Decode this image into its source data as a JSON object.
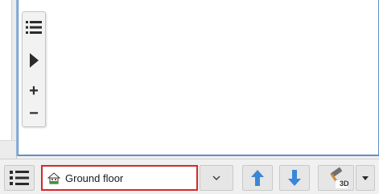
{
  "palette": {
    "items": [
      {
        "name": "list-icon"
      },
      {
        "name": "play-icon"
      },
      {
        "name": "zoom-in-icon",
        "glyph": "+"
      },
      {
        "name": "zoom-out-icon",
        "glyph": "−"
      }
    ]
  },
  "toolbar": {
    "floor_selector": {
      "value": "Ground floor",
      "icon": "floor-house-icon"
    },
    "buttons": [
      {
        "name": "levels-list-button",
        "icon": "list-icon"
      },
      {
        "name": "floor-dropdown-button",
        "icon": "chevron-down-icon"
      },
      {
        "name": "level-up-button",
        "icon": "arrow-up-icon"
      },
      {
        "name": "level-down-button",
        "icon": "arrow-down-icon"
      },
      {
        "name": "build-3d-button",
        "icon": "hammer-3d-icon",
        "badge": "3D"
      },
      {
        "name": "build-options-button",
        "icon": "caret-down-icon"
      }
    ]
  },
  "colors": {
    "accent_blue": "#3b87d6",
    "selection_red": "#d32a2a",
    "canvas_border": "#5e90c8"
  }
}
